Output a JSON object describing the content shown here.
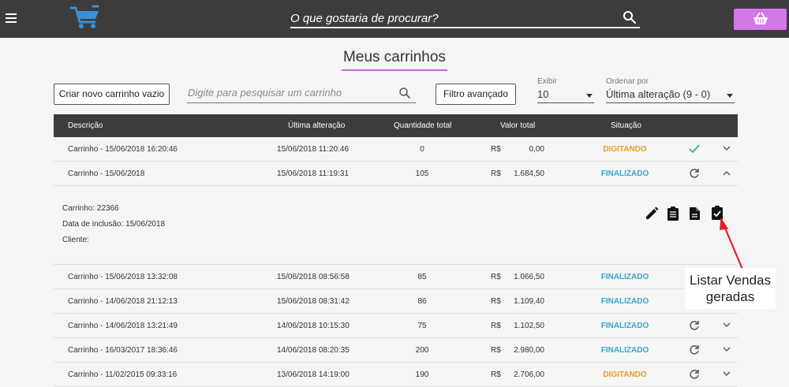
{
  "header": {
    "search_placeholder": "O que gostaria de procurar?"
  },
  "title": "Meus carrinhos",
  "toolbar": {
    "new_cart_label": "Criar novo carrinho vazio",
    "cart_search_placeholder": "Digite para pesquisar um carrinho",
    "advanced_filter_label": "Filtro avançado",
    "show_label": "Exibir",
    "show_value": "10",
    "sort_label": "Ordenar por",
    "sort_value": "Última alteração (9 - 0)"
  },
  "table": {
    "headers": {
      "description": "Descrição",
      "last_change": "Última alteração",
      "quantity": "Quantidade total",
      "value": "Valor total",
      "status": "Situação"
    },
    "currency": "R$",
    "rows": [
      {
        "description": "Carrinho - 15/06/2018 16:20:46",
        "last_change": "15/06/2018 11:20:46",
        "quantity": "0",
        "value": "0,00",
        "status": "DIGITANDO"
      },
      {
        "description": "Carrinho - 15/06/2018",
        "last_change": "15/06/2018 11:19:31",
        "quantity": "105",
        "value": "1.684,50",
        "status": "FINALIZADO"
      },
      {
        "description": "Carrinho - 15/06/2018 13:32:08",
        "last_change": "15/06/2018 08:56:58",
        "quantity": "85",
        "value": "1.066,50",
        "status": "FINALIZADO"
      },
      {
        "description": "Carrinho - 14/06/2018 21:12:13",
        "last_change": "15/06/2018 08:31:42",
        "quantity": "86",
        "value": "1.109,40",
        "status": "FINALIZADO"
      },
      {
        "description": "Carrinho - 14/06/2018 13:21:49",
        "last_change": "14/06/2018 10:15:30",
        "quantity": "75",
        "value": "1.102,50",
        "status": "FINALIZADO"
      },
      {
        "description": "Carrinho - 16/03/2017 18:36:46",
        "last_change": "14/06/2018 08:20:35",
        "quantity": "200",
        "value": "2.980,00",
        "status": "FINALIZADO"
      },
      {
        "description": "Carrinho - 11/02/2015 09:33:16",
        "last_change": "13/06/2018 14:19:00",
        "quantity": "190",
        "value": "2.706,00",
        "status": "DIGITANDO"
      }
    ],
    "detail": {
      "cart_label": "Carrinho:",
      "cart_value": "22366",
      "inclusion_label": "Data de inclusão:",
      "inclusion_value": "15/06/2018",
      "client_label": "Cliente:"
    }
  },
  "callout": {
    "line1": "Listar Vendas",
    "line2": "geradas"
  },
  "colors": {
    "header_bg": "#3c3c3c",
    "accent": "#c36bd9",
    "basket_button": "#d477e8",
    "status_digitando": "#e89f1f",
    "status_finalizado": "#3aa5c9",
    "check_green": "#3cb371",
    "annotation_arrow": "#e0202a"
  }
}
